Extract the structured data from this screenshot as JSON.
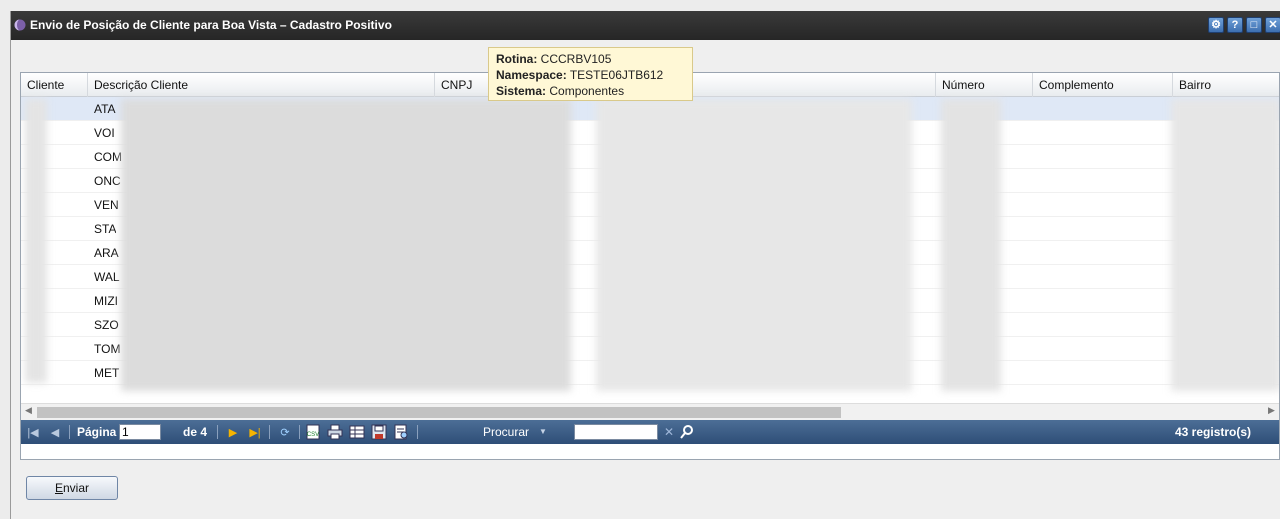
{
  "window": {
    "title": "Envio de Posição de Cliente para Boa Vista – Cadastro Positivo",
    "buttons": [
      "gear-icon",
      "help-icon",
      "maximize-icon",
      "close-icon"
    ]
  },
  "tooltip": {
    "rotina_label": "Rotina:",
    "rotina_value": "CCCRBV105",
    "namespace_label": "Namespace:",
    "namespace_value": "TESTE06JTB612",
    "sistema_label": "Sistema:",
    "sistema_value": "Componentes"
  },
  "grid": {
    "columns": [
      "Cliente",
      "Descrição Cliente",
      "CNPJ",
      "",
      "Número",
      "Complemento",
      "Bairro"
    ],
    "rows": [
      {
        "descricao": "ATA"
      },
      {
        "descricao": "VOI"
      },
      {
        "descricao": "COM"
      },
      {
        "descricao": "ONC"
      },
      {
        "descricao": "VEN"
      },
      {
        "descricao": "STA"
      },
      {
        "descricao": "ARA"
      },
      {
        "descricao": "WAL"
      },
      {
        "descricao": "MIZI"
      },
      {
        "descricao": "SZO"
      },
      {
        "descricao": "TOM"
      },
      {
        "descricao": "MET"
      }
    ]
  },
  "toolbar": {
    "pagina_label": "Página",
    "page_value": "1",
    "de_label": "de 4",
    "procurar_label": "Procurar",
    "registros": "43 registro(s)",
    "accent": "#2e4e77"
  },
  "actions": {
    "enviar_first": "E",
    "enviar_rest": "nviar"
  }
}
